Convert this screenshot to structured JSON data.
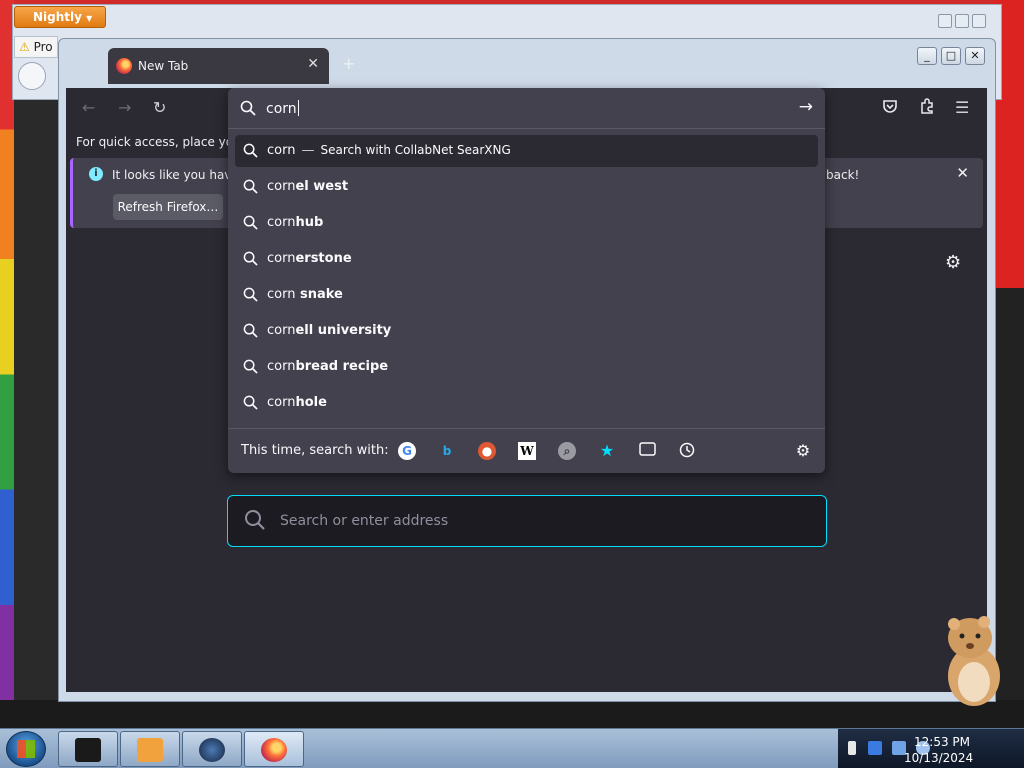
{
  "back_window": {
    "app_button": "Nightly",
    "tab_label": "Pro"
  },
  "window": {
    "tab_title": "New Tab",
    "new_tab_symbol": "+"
  },
  "toolbar": {
    "quick_access": "For quick access, place your b"
  },
  "notice": {
    "message": "It looks like you haven",
    "message_end": "back!",
    "refresh_button": "Refresh Firefox…"
  },
  "urlbar": {
    "typed": "corn",
    "action_engine": "Search with CollabNet SearXNG",
    "suggestions": [
      {
        "prefix": "corn",
        "suffix": "el west"
      },
      {
        "prefix": "corn",
        "suffix": "hub"
      },
      {
        "prefix": "corn",
        "suffix": "erstone"
      },
      {
        "prefix": "corn",
        "suffix": " snake"
      },
      {
        "prefix": "corn",
        "suffix": "ell university"
      },
      {
        "prefix": "corn",
        "suffix": "bread recipe"
      },
      {
        "prefix": "corn",
        "suffix": "hole"
      }
    ],
    "search_with_label": "This time, search with:",
    "engines": [
      "google-icon",
      "bing-icon",
      "duckduckgo-icon",
      "wikipedia-icon",
      "searxng-icon",
      "bookmarks-icon",
      "tabs-icon",
      "history-icon"
    ]
  },
  "newtab_search": {
    "placeholder": "Search or enter address"
  },
  "taskbar": {
    "time": "12:53 PM",
    "date": "10/13/2024"
  },
  "colors": {
    "content_bg": "#2b2a33",
    "popup_bg": "#42414d",
    "focus_ring": "#00ddff",
    "nightly_orange": "#e07b12"
  }
}
